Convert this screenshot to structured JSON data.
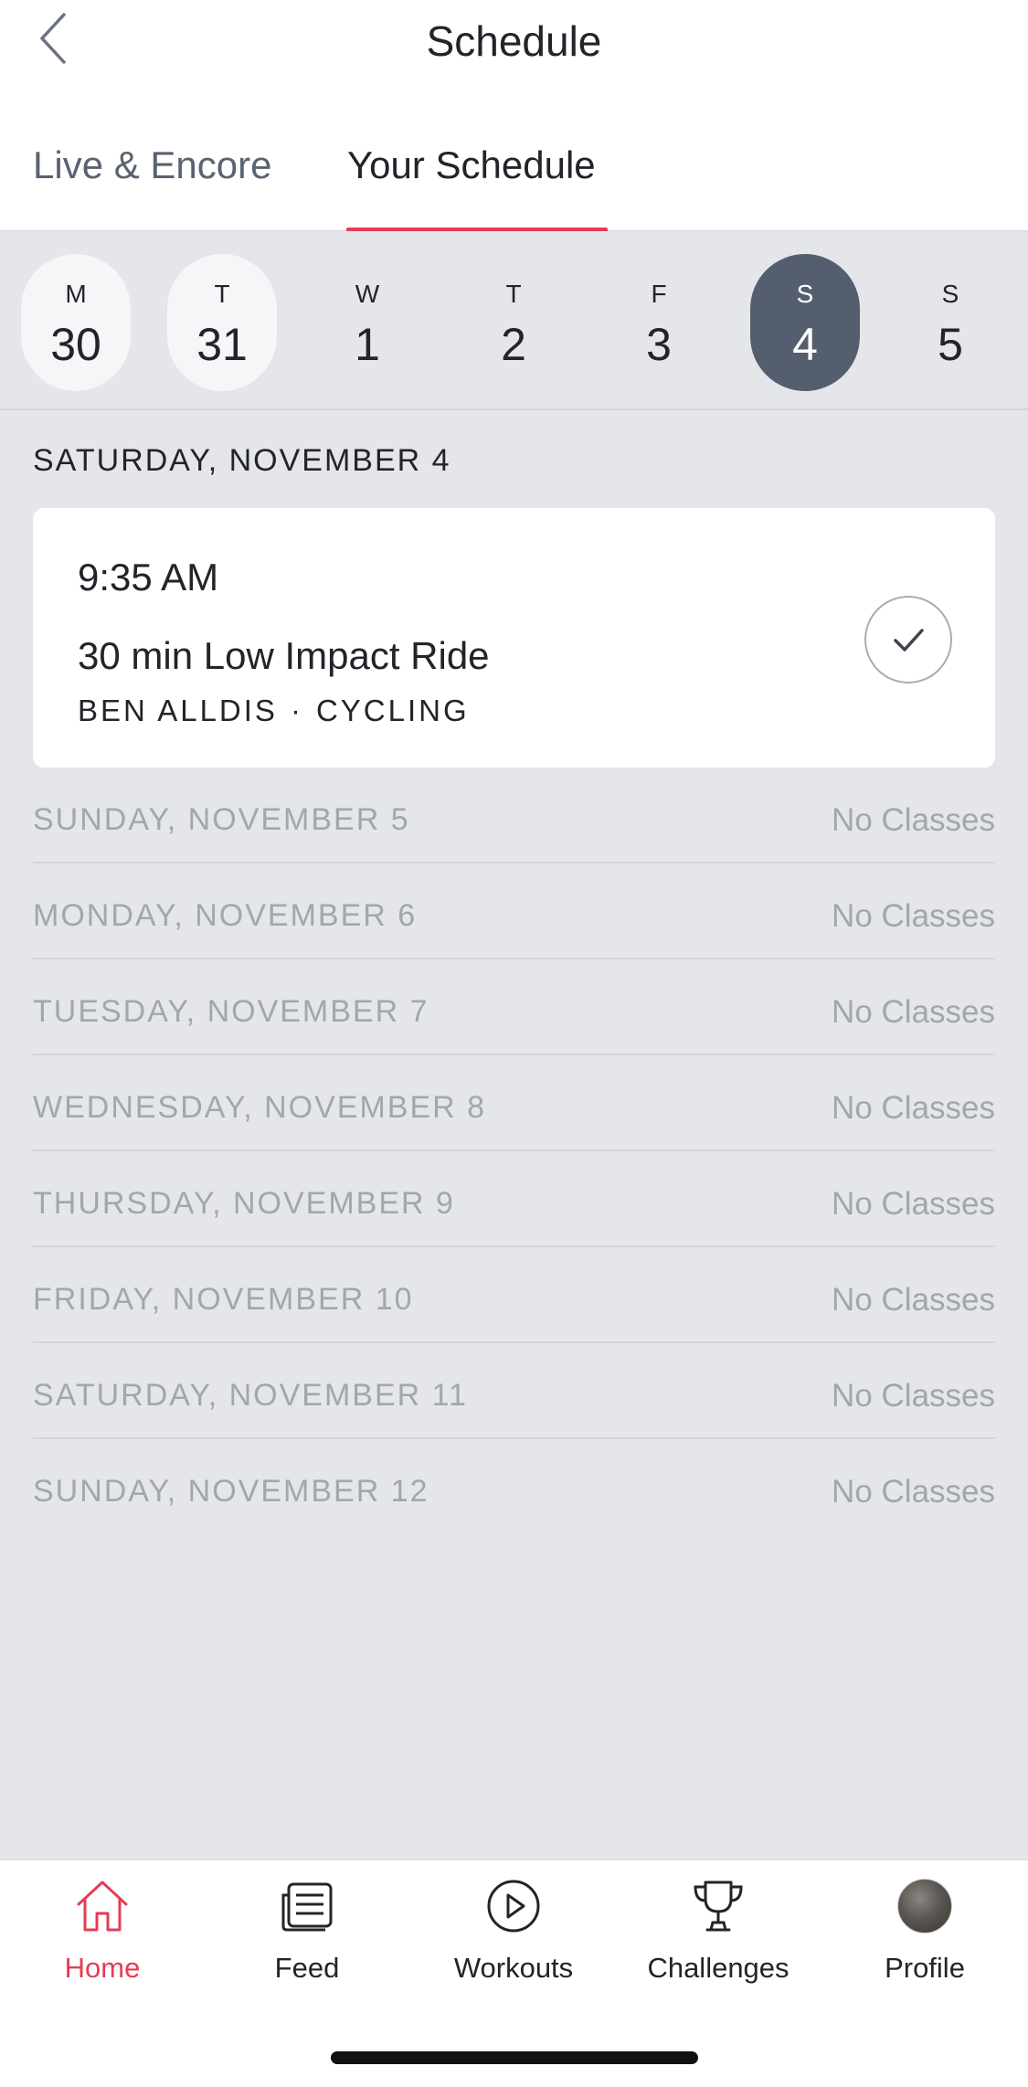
{
  "header": {
    "title": "Schedule"
  },
  "tabs": [
    {
      "label": "Live & Encore",
      "active": false
    },
    {
      "label": "Your Schedule",
      "active": true
    }
  ],
  "week": [
    {
      "letter": "M",
      "number": "30",
      "state": "past"
    },
    {
      "letter": "T",
      "number": "31",
      "state": "past"
    },
    {
      "letter": "W",
      "number": "1",
      "state": "normal"
    },
    {
      "letter": "T",
      "number": "2",
      "state": "normal"
    },
    {
      "letter": "F",
      "number": "3",
      "state": "normal"
    },
    {
      "letter": "S",
      "number": "4",
      "state": "selected"
    },
    {
      "letter": "S",
      "number": "5",
      "state": "normal"
    }
  ],
  "selected_day": {
    "heading": "SATURDAY, NOVEMBER 4",
    "class": {
      "time": "9:35 AM",
      "title": "30 min Low Impact Ride",
      "instructor": "BEN ALLDIS",
      "separator": "·",
      "category": "CYCLING"
    }
  },
  "upcoming": [
    {
      "date": "SUNDAY, NOVEMBER 5",
      "status": "No Classes"
    },
    {
      "date": "MONDAY, NOVEMBER 6",
      "status": "No Classes"
    },
    {
      "date": "TUESDAY, NOVEMBER 7",
      "status": "No Classes"
    },
    {
      "date": "WEDNESDAY, NOVEMBER 8",
      "status": "No Classes"
    },
    {
      "date": "THURSDAY, NOVEMBER 9",
      "status": "No Classes"
    },
    {
      "date": "FRIDAY, NOVEMBER 10",
      "status": "No Classes"
    },
    {
      "date": "SATURDAY, NOVEMBER 11",
      "status": "No Classes"
    },
    {
      "date": "SUNDAY, NOVEMBER 12",
      "status": "No Classes"
    }
  ],
  "nav": [
    {
      "label": "Home",
      "icon": "home-icon",
      "active": true
    },
    {
      "label": "Feed",
      "icon": "feed-icon",
      "active": false
    },
    {
      "label": "Workouts",
      "icon": "play-circle-icon",
      "active": false
    },
    {
      "label": "Challenges",
      "icon": "trophy-icon",
      "active": false
    },
    {
      "label": "Profile",
      "icon": "avatar",
      "active": false
    }
  ],
  "colors": {
    "accent": "#e43d54",
    "selected_day": "#555e6e",
    "background": "#e4e6ea",
    "muted_text": "#a2a6ad"
  }
}
